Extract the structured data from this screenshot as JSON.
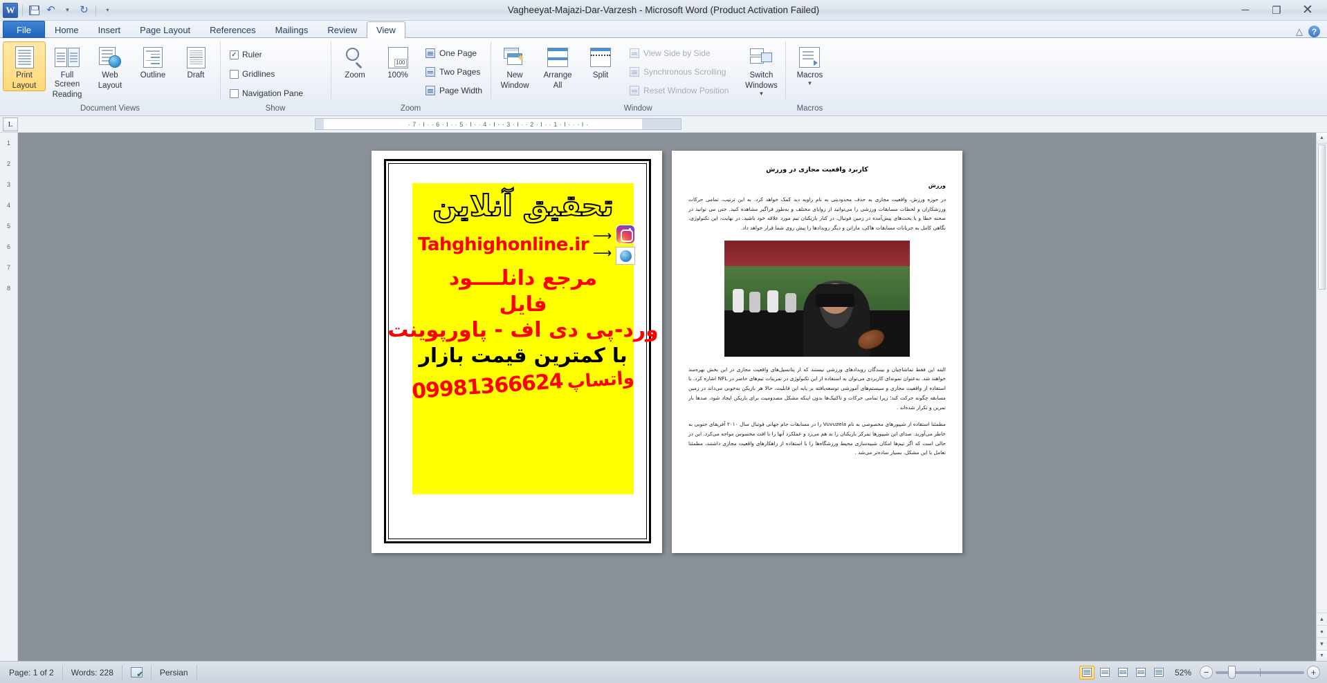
{
  "titlebar": {
    "app_icon": "word-logo",
    "document_title": "Vagheeyat-Majazi-Dar-Varzesh  -  Microsoft Word (Product Activation Failed)",
    "quick_access": [
      {
        "name": "save",
        "icon": "save-icon"
      },
      {
        "name": "undo",
        "icon": "undo-icon"
      },
      {
        "name": "undo-dropdown",
        "icon": "chevron-down-icon"
      },
      {
        "name": "redo",
        "icon": "redo-icon"
      },
      {
        "name": "customize-qat",
        "icon": "chevron-down-icon"
      }
    ],
    "window_controls": {
      "minimize": "─",
      "restore": "❐",
      "close": "✕"
    }
  },
  "tabs": [
    {
      "label": "File",
      "active": false,
      "type": "file"
    },
    {
      "label": "Home",
      "active": false
    },
    {
      "label": "Insert",
      "active": false
    },
    {
      "label": "Page Layout",
      "active": false
    },
    {
      "label": "References",
      "active": false
    },
    {
      "label": "Mailings",
      "active": false
    },
    {
      "label": "Review",
      "active": false
    },
    {
      "label": "View",
      "active": true
    }
  ],
  "tabs_right": {
    "minimize_ribbon": "△",
    "help": "?"
  },
  "ribbon": {
    "groups": [
      {
        "label": "Document Views",
        "buttons": [
          {
            "label_line1": "Print",
            "label_line2": "Layout",
            "icon": "print-layout-icon",
            "selected": true
          },
          {
            "label_line1": "Full Screen",
            "label_line2": "Reading",
            "icon": "full-screen-reading-icon",
            "selected": false
          },
          {
            "label_line1": "Web",
            "label_line2": "Layout",
            "icon": "web-layout-icon",
            "selected": false
          },
          {
            "label_line1": "Outline",
            "label_line2": "",
            "icon": "outline-icon",
            "selected": false
          },
          {
            "label_line1": "Draft",
            "label_line2": "",
            "icon": "draft-icon",
            "selected": false
          }
        ]
      },
      {
        "label": "Show",
        "checkboxes": [
          {
            "label": "Ruler",
            "checked": true
          },
          {
            "label": "Gridlines",
            "checked": false
          },
          {
            "label": "Navigation Pane",
            "checked": false
          }
        ]
      },
      {
        "label": "Zoom",
        "buttons": [
          {
            "label_line1": "Zoom",
            "label_line2": "",
            "icon": "magnifier-icon"
          },
          {
            "label_line1": "100%",
            "label_line2": "",
            "icon": "zoom-100-icon"
          }
        ],
        "items": [
          {
            "label": "One Page",
            "icon": "one-page-icon"
          },
          {
            "label": "Two Pages",
            "icon": "two-pages-icon"
          },
          {
            "label": "Page Width",
            "icon": "page-width-icon"
          }
        ]
      },
      {
        "label": "Window",
        "buttons": [
          {
            "label_line1": "New",
            "label_line2": "Window",
            "icon": "new-window-icon"
          },
          {
            "label_line1": "Arrange",
            "label_line2": "All",
            "icon": "arrange-all-icon"
          },
          {
            "label_line1": "Split",
            "label_line2": "",
            "icon": "split-icon"
          },
          {
            "label_line1": "Switch",
            "label_line2": "Windows",
            "icon": "switch-windows-icon",
            "has_caret": true
          }
        ],
        "items": [
          {
            "label": "View Side by Side",
            "icon": "side-by-side-icon",
            "disabled": true
          },
          {
            "label": "Synchronous Scrolling",
            "icon": "sync-scroll-icon",
            "disabled": true
          },
          {
            "label": "Reset Window Position",
            "icon": "reset-window-icon",
            "disabled": true
          }
        ]
      },
      {
        "label": "Macros",
        "buttons": [
          {
            "label_line1": "Macros",
            "label_line2": "",
            "icon": "macros-icon",
            "has_caret": true
          }
        ]
      }
    ]
  },
  "ruler": {
    "tab_stop_marker": "L",
    "horizontal_ticks": "· 7 · I · · 6 · I · · 5 · I · · 4 · I · · 3 · I · · 2 · I · · 1 · I · · · I ·",
    "vertical_ticks": [
      "1",
      "2",
      "3",
      "4",
      "5",
      "6",
      "7",
      "8"
    ]
  },
  "document": {
    "page1": {
      "type": "advertisement",
      "background_color": "#ffff00",
      "title": "تحقیق آنلاین",
      "url": "Tahghighonline.ir",
      "icons": [
        "instagram-icon",
        "telegram-icon",
        "arrow-left-icon",
        "arrow-left-icon"
      ],
      "lines": [
        "مرجع دانلــــود",
        "فایل",
        "ورد-پی دی اف - پاورپوینت",
        "با کمترین قیمت بازار"
      ],
      "phone": "09981366624",
      "whatsapp_label": "واتساپ"
    },
    "page2": {
      "heading": "کاربرد واقعیت مجازی در ورزش",
      "subheading": "ورزش",
      "paragraphs": [
        "در حوزه ورزش، واقعیت مجازی به حذف محدودیتی به نام زاویه دید کمک خواهد کرد. به این ترتیب، تمامی حرکات ورزشکاران و لحظات مسابقات ورزشی را می‌توانید از زوایای مختلف و به‌طور فراگیر مشاهده کنید. حتی می توانید در صحنه خطا و یا بحث‌های پیش‌آمده در زمین فوتبال، در کنار بازیکنان تیم مورد علاقه خود باشید. در نهایت، این تکنولوژی، نگاهی کامل به جریانات مسابقات هاکی، ماراتن و دیگر رویدادها را پیش روی شما قرار خواهد داد."
      ],
      "paragraphs_after_image": [
        "البته این فقط تماشاچیان و بینندگان رویدادهای ورزشی نیستند که از پتانسیل‌های واقعیت مجازی در این بخش بهره‌مند خواهند شد. به‌عنوان نمونه‌ای کاربردی می‌توان به استفاده از این تکنولوژی در تمرینات تیم‌های حاضر در NFL اشاره کرد. با استفاده از واقعیت مجازی و سیستم‌های آموزشی توسعه‌یافته بر پایه این قابلیت، حالا هر بازیکن به‌خوبی می‌داند در زمین مسابقه چگونه حرکت کند؛ زیرا تمامی حرکات و تاکتیک‌ها بدون اینکه مشکل مصدومیت برای بازیکن ایجاد شود، صدها بار تمرین و تکرار شده‌اند .",
        "مطمئنا استفاده از شیپورهای مخصوصی به نام Vuvuzela را در مسابقات جام جهانی فوتبال سال ۲۰۱۰ آفریقای جنوبی به خاطر می‌آورید. صدای این شیپورها تمرکز بازیکنان را به هم می‌زد و عملکرد آنها را با افت محسوس مواجه می‌کرد. این در حالی است که اگر تیم‌ها امکان شبیه‌سازی محیط ورزشگاه‌ها را با استفاده از راهکارهای واقعیت مجازی داشتند، مطمئنا تعامل با این مشکل، بسیار ساده‌تر می‌شد ."
      ],
      "image_caption": "football-vr-photo"
    }
  },
  "statusbar": {
    "page": "Page: 1 of 2",
    "words": "Words: 228",
    "proofing_icon": "spell-check-icon",
    "language": "Persian",
    "view_buttons": [
      {
        "name": "print-layout-view",
        "selected": true
      },
      {
        "name": "full-screen-reading-view",
        "selected": false
      },
      {
        "name": "web-layout-view",
        "selected": false
      },
      {
        "name": "outline-view",
        "selected": false
      },
      {
        "name": "draft-view",
        "selected": false
      }
    ],
    "zoom_level": "52%",
    "zoom_out": "−",
    "zoom_in": "+"
  }
}
